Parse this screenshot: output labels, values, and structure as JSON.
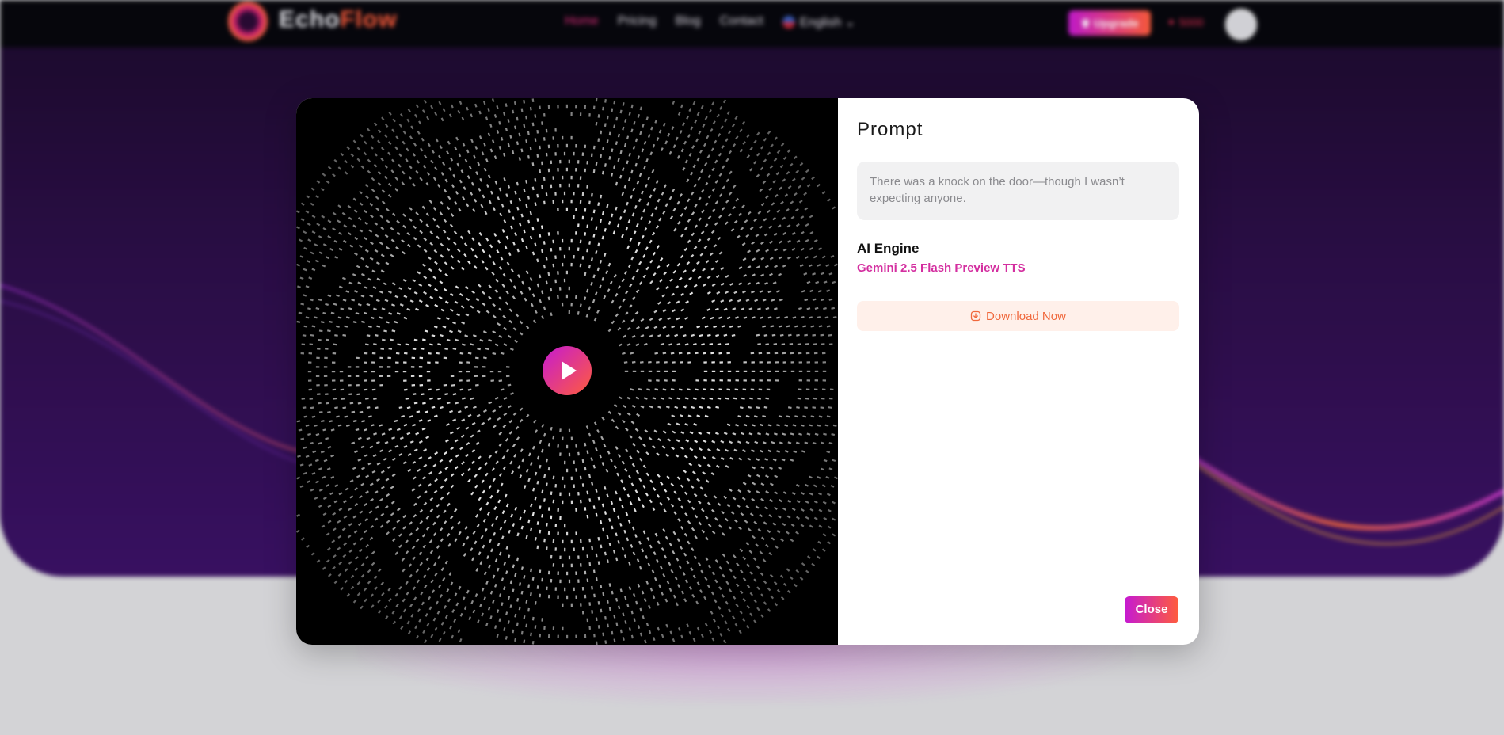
{
  "background": {
    "brand": {
      "logo_word": "Echo",
      "logo_accent": "Flow"
    },
    "nav": {
      "links": [
        "Home",
        "Pricing",
        "Blog",
        "Contact"
      ],
      "language": "English",
      "upgrade_label": "Upgrade",
      "credits_label": "5000"
    }
  },
  "modal": {
    "panel_title": "Prompt",
    "prompt_text": "There was a knock on the door—though I wasn’t expecting anyone.",
    "engine_label": "AI Engine",
    "engine_value": "Gemini 2.5 Flash Preview TTS",
    "download_label": "Download Now",
    "close_label": "Close",
    "icons": {
      "play": "play-icon",
      "download": "download-icon"
    }
  },
  "colors": {
    "accent_start": "#c51ad2",
    "accent_end": "#ff5c3d",
    "engine_text": "#d42fa0",
    "download_text": "#f0683c",
    "download_bg": "#fff0ea"
  }
}
